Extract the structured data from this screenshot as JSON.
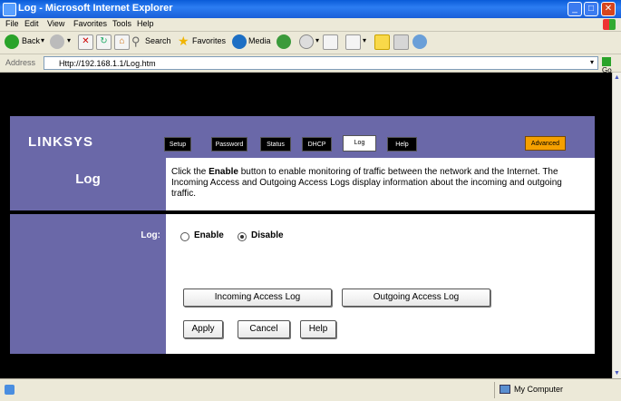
{
  "window": {
    "title": "Log - Microsoft Internet Explorer"
  },
  "menu": [
    "File",
    "Edit",
    "View",
    "Favorites",
    "Tools",
    "Help"
  ],
  "toolbar": {
    "back_label": "Back",
    "search_label": "Search",
    "favorites_label": "Favorites",
    "media_label": "Media"
  },
  "address": {
    "label": "Address",
    "url": "Http://192.168.1.1/Log.htm",
    "go_label": "Go"
  },
  "router": {
    "brand": "LINKSYS",
    "tabs": [
      "Setup",
      "Password",
      "Status",
      "DHCP",
      "Log",
      "Help"
    ],
    "advanced_label": "Advanced",
    "page_title": "Log",
    "desc_pre": "Click the ",
    "desc_bold": "Enable",
    "desc_post": " button to enable monitoring of traffic between the network and the Internet. The Incoming Access and Outgoing Access Logs display information about the incoming and outgoing traffic.",
    "log_label": "Log:",
    "enable_label": "Enable",
    "disable_label": "Disable",
    "incoming_btn": "Incoming Access Log",
    "outgoing_btn": "Outgoing Access Log",
    "apply_btn": "Apply",
    "cancel_btn": "Cancel",
    "help_btn": "Help"
  },
  "status": {
    "zone": "My Computer"
  },
  "colors": {
    "accent_purple": "#6a68a8",
    "advanced_orange": "#f5a000",
    "titlebar_blue": "#0a5bd8"
  }
}
